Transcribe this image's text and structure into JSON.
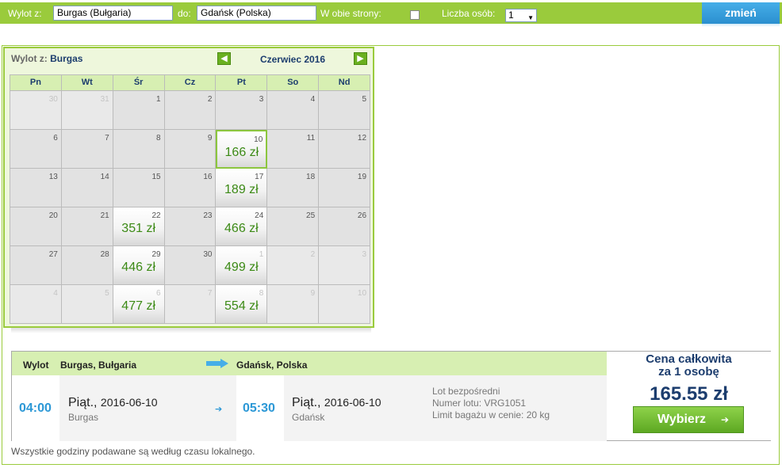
{
  "search": {
    "from_label": "Wylot z:",
    "from_value": "Burgas (Bułgaria)",
    "to_label": "do:",
    "to_value": "Gdańsk (Polska)",
    "roundtrip_label": "W obie strony:",
    "persons_label": "Liczba osób:",
    "persons_value": "1",
    "change_label": "zmień"
  },
  "calendar": {
    "from_prefix": "Wylot z:",
    "from_city": "Burgas",
    "month_label": "Czerwiec 2016",
    "prev_icon": "arrow-left-icon",
    "next_icon": "arrow-right-icon",
    "weekdays": [
      "Pn",
      "Wt",
      "Śr",
      "Cz",
      "Pt",
      "So",
      "Nd"
    ],
    "weeks": [
      [
        {
          "d": "30",
          "o": true
        },
        {
          "d": "31",
          "o": true
        },
        {
          "d": "1"
        },
        {
          "d": "2"
        },
        {
          "d": "3"
        },
        {
          "d": "4"
        },
        {
          "d": "5"
        }
      ],
      [
        {
          "d": "6"
        },
        {
          "d": "7"
        },
        {
          "d": "8"
        },
        {
          "d": "9"
        },
        {
          "d": "10",
          "p": "166 zł",
          "s": true
        },
        {
          "d": "11"
        },
        {
          "d": "12"
        }
      ],
      [
        {
          "d": "13"
        },
        {
          "d": "14"
        },
        {
          "d": "15"
        },
        {
          "d": "16"
        },
        {
          "d": "17",
          "p": "189 zł"
        },
        {
          "d": "18"
        },
        {
          "d": "19"
        }
      ],
      [
        {
          "d": "20"
        },
        {
          "d": "21"
        },
        {
          "d": "22",
          "p": "351 zł"
        },
        {
          "d": "23"
        },
        {
          "d": "24",
          "p": "466 zł"
        },
        {
          "d": "25"
        },
        {
          "d": "26"
        }
      ],
      [
        {
          "d": "27"
        },
        {
          "d": "28"
        },
        {
          "d": "29",
          "p": "446 zł"
        },
        {
          "d": "30"
        },
        {
          "d": "1",
          "o": true,
          "p": "499 zł"
        },
        {
          "d": "2",
          "o": true
        },
        {
          "d": "3",
          "o": true
        }
      ],
      [
        {
          "d": "4",
          "o": true
        },
        {
          "d": "5",
          "o": true
        },
        {
          "d": "6",
          "o": true,
          "p": "477 zł"
        },
        {
          "d": "7",
          "o": true
        },
        {
          "d": "8",
          "o": true,
          "p": "554 zł"
        },
        {
          "d": "9",
          "o": true
        },
        {
          "d": "10",
          "o": true
        }
      ]
    ]
  },
  "flight": {
    "header_label": "Wylot",
    "from": "Burgas, Bułgaria",
    "to": "Gdańsk, Polska",
    "dep_time": "04:00",
    "dep_day": "Piąt.,",
    "dep_date": "2016-06-10",
    "dep_city": "Burgas",
    "arr_time": "05:30",
    "arr_day": "Piąt.,",
    "arr_date": "2016-06-10",
    "arr_city": "Gdańsk",
    "info1": "Lot bezpośredni",
    "info2": "Numer lotu: VRG1051",
    "info3": "Limit bagażu w cenie: 20 kg",
    "price_title_1": "Cena całkowita",
    "price_title_2": "za 1 osobę",
    "price": "165.55 zł",
    "choose_label": "Wybierz",
    "accent_color": "#9acb3c",
    "time_color": "#2c98d6"
  },
  "footnote": "Wszystkie godziny podawane są według czasu lokalnego."
}
